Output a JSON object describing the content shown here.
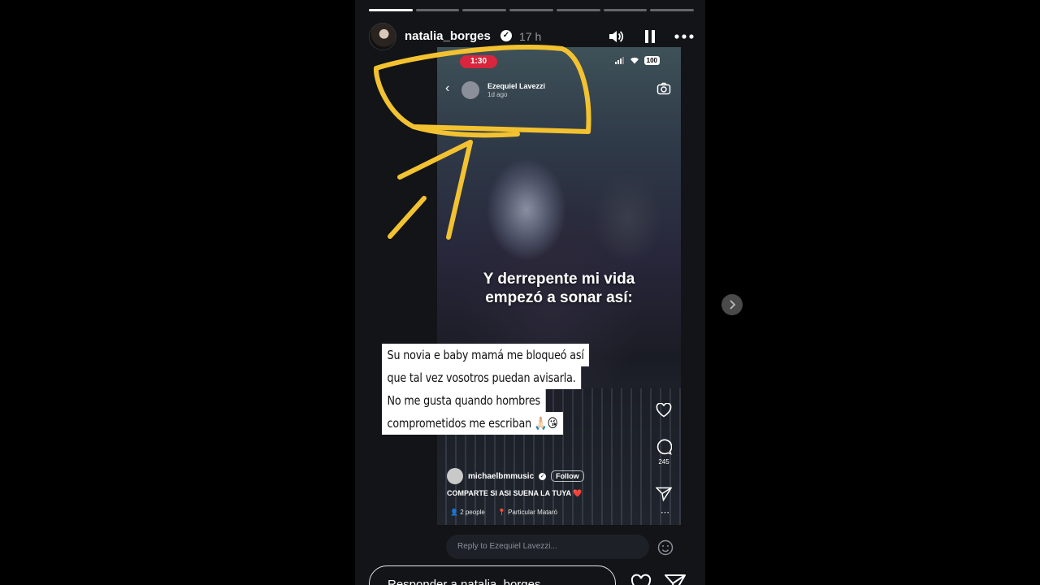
{
  "story": {
    "progress_segments": 7,
    "progress_done": 1,
    "username": "natalia_borges",
    "time": "17 h",
    "reply_placeholder": "Responder a natalia_borges..."
  },
  "screenshot": {
    "timer": "1:30",
    "battery": "100",
    "profile_name": "Ezequiel Lavezzi",
    "posted_ago": "1d ago",
    "caption_line1": "Y derrepente mi vida",
    "caption_line2": "empezó a sonar así:",
    "comment_count": "245",
    "music_user": "michaelbmmusic",
    "follow_label": "Follow",
    "post_text": "COMPARTE SI ASI SUENA LA TUYA ❤️",
    "people": "2 people",
    "location": "Particular Mataró",
    "reply_placeholder": "Reply to Ezequiel Lavezzi..."
  },
  "overlay_text": {
    "line1": "Su novia e baby mamá me bloqueó así",
    "line2": "que tal vez vosotros puedan avisarla.",
    "line3": "No me gusta quando hombres",
    "line4": "comprometidos me escriban 🙏🏻😘"
  },
  "colors": {
    "timer_red": "#d7263d",
    "scribble_yellow": "#f2c230",
    "story_bg": "#121417"
  },
  "icons": [
    "speaker-icon",
    "pause-icon",
    "more-icon",
    "heart-icon",
    "send-icon",
    "chevron-right-icon",
    "camera-icon",
    "back-icon",
    "comment-icon",
    "sticker-icon"
  ]
}
